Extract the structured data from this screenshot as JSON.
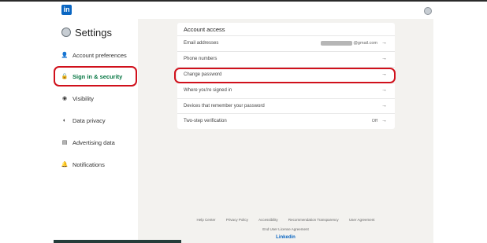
{
  "topbar": {
    "logo_text": "in",
    "logo_icon": "linkedin-logo-icon",
    "avatar_icon": "user-avatar-icon"
  },
  "sidebar": {
    "title": "Settings",
    "items": [
      {
        "label": "Account preferences",
        "icon": "person-icon",
        "glyph": "👤"
      },
      {
        "label": "Sign in & security",
        "icon": "lock-icon",
        "glyph": "🔒",
        "active": true
      },
      {
        "label": "Visibility",
        "icon": "eye-icon",
        "glyph": "◉"
      },
      {
        "label": "Data privacy",
        "icon": "shield-icon",
        "glyph": "◐"
      },
      {
        "label": "Advertising data",
        "icon": "newspaper-icon",
        "glyph": "▤"
      },
      {
        "label": "Notifications",
        "icon": "bell-icon",
        "glyph": "🔔"
      }
    ]
  },
  "account_access": {
    "title": "Account access",
    "rows": [
      {
        "label": "Email addresses",
        "value": "@gmail.com",
        "value_redacted": true
      },
      {
        "label": "Phone numbers",
        "value": ""
      },
      {
        "label": "Change password",
        "value": ""
      },
      {
        "label": "Where you're signed in",
        "value": ""
      },
      {
        "label": "Devices that remember your password",
        "value": ""
      },
      {
        "label": "Two-step verification",
        "value": "Off"
      }
    ],
    "arrow": "→"
  },
  "footer": {
    "links": [
      "Help Center",
      "Privacy Policy",
      "Accessibility",
      "Recommendation Transparency",
      "User Agreement"
    ],
    "eula": "End User License Agreement",
    "brand": "Linkedin"
  },
  "colors": {
    "accent_green": "#057642",
    "highlight_red": "#d0101b",
    "brand_blue": "#0a66c2",
    "main_bg": "#f3f2ef"
  }
}
